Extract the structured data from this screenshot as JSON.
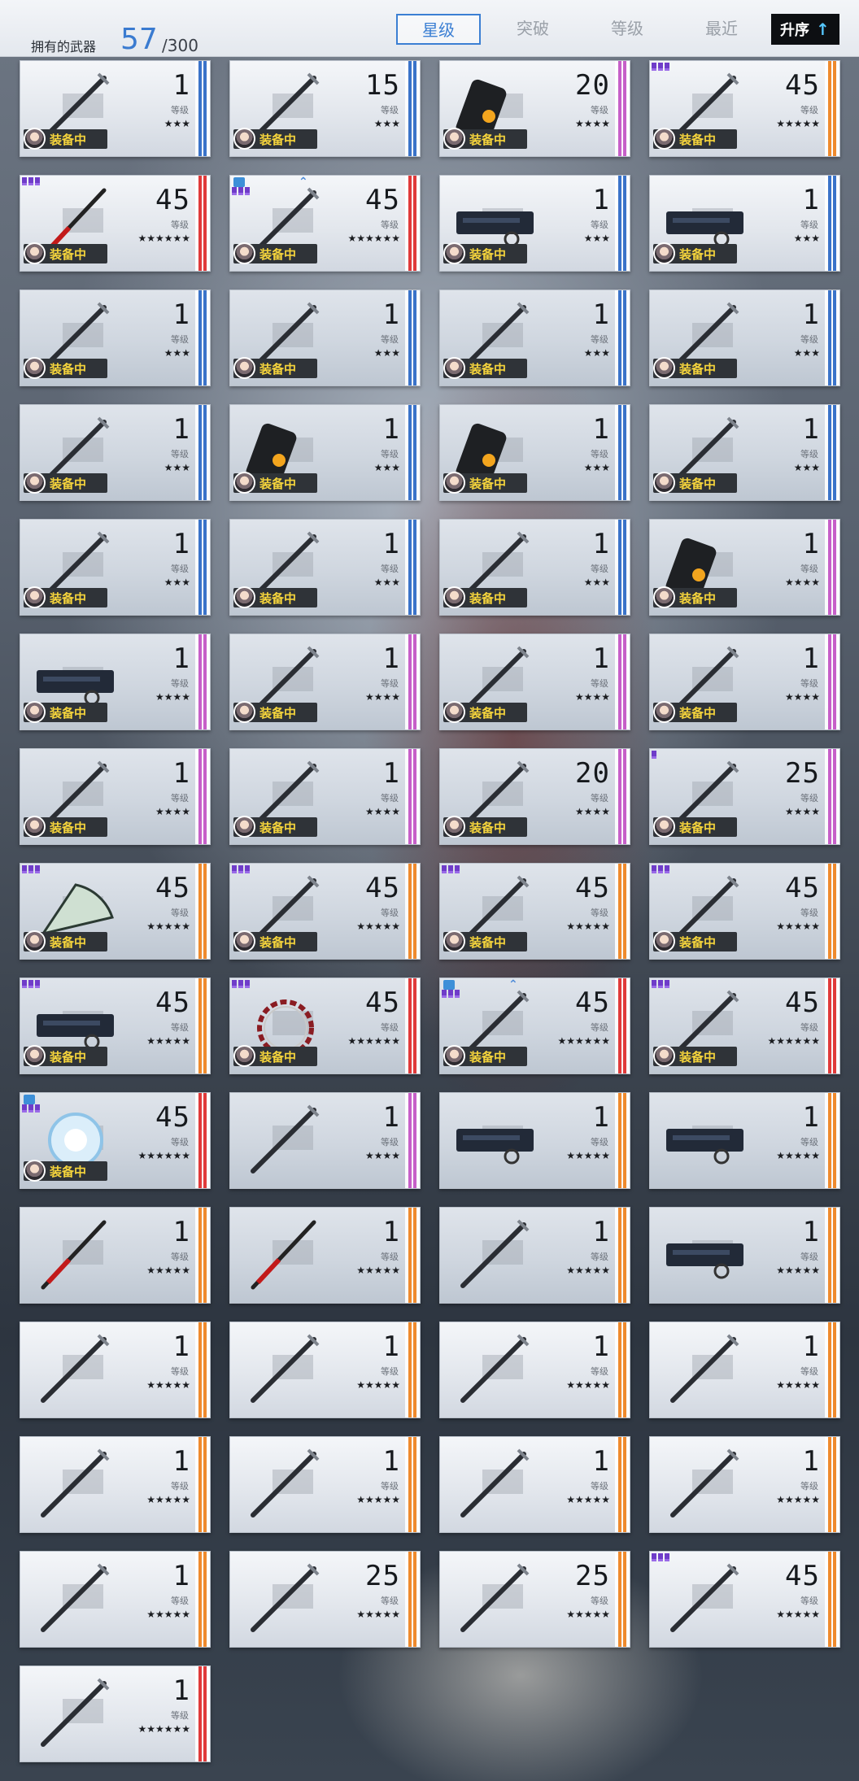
{
  "header": {
    "owned_label": "拥有的武器",
    "owned_count": "57",
    "owned_total": "/300",
    "tabs": [
      {
        "label": "星级",
        "active": true
      },
      {
        "label": "突破",
        "active": false
      },
      {
        "label": "等级",
        "active": false
      },
      {
        "label": "最近",
        "active": false
      }
    ],
    "sort_label": "升序",
    "sort_arrow": "↑"
  },
  "labels": {
    "level": "等级",
    "equipped": "装备中"
  },
  "rarity_colors": {
    "3": "#3a73c9",
    "4": "#c65fc8",
    "5": "#ef8a2d",
    "6": "#e03a3a"
  },
  "weapons": [
    {
      "level": "1",
      "stars": 3,
      "equipped": true,
      "weapon": "scythe-dark-icon"
    },
    {
      "level": "15",
      "stars": 3,
      "equipped": true,
      "weapon": "katana-icon"
    },
    {
      "level": "20",
      "stars": 4,
      "equipped": true,
      "weapon": "gauntlet-cannon-icon"
    },
    {
      "level": "45",
      "stars": 5,
      "equipped": true,
      "weapon": "claw-blades-icon",
      "rank": 3
    },
    {
      "level": "45",
      "stars": 6,
      "equipped": true,
      "weapon": "red-sword-icon",
      "rank": 3
    },
    {
      "level": "45",
      "stars": 6,
      "equipped": true,
      "weapon": "lance-icon",
      "rank": 3,
      "lock": true,
      "upgrade": true
    },
    {
      "level": "1",
      "stars": 3,
      "equipped": true,
      "weapon": "gun-block-icon"
    },
    {
      "level": "1",
      "stars": 3,
      "equipped": true,
      "weapon": "gun-block-icon"
    },
    {
      "level": "1",
      "stars": 3,
      "equipped": true,
      "weapon": "sword-icon"
    },
    {
      "level": "1",
      "stars": 3,
      "equipped": true,
      "weapon": "sword-icon"
    },
    {
      "level": "1",
      "stars": 3,
      "equipped": true,
      "weapon": "sword-icon"
    },
    {
      "level": "1",
      "stars": 3,
      "equipped": true,
      "weapon": "cannon-icon"
    },
    {
      "level": "1",
      "stars": 3,
      "equipped": true,
      "weapon": "dagger-icon"
    },
    {
      "level": "1",
      "stars": 3,
      "equipped": true,
      "weapon": "gauntlet-icon"
    },
    {
      "level": "1",
      "stars": 3,
      "equipped": true,
      "weapon": "gauntlet-icon"
    },
    {
      "level": "1",
      "stars": 3,
      "equipped": true,
      "weapon": "curved-blade-icon"
    },
    {
      "level": "1",
      "stars": 3,
      "equipped": true,
      "weapon": "curved-blade-icon"
    },
    {
      "level": "1",
      "stars": 3,
      "equipped": true,
      "weapon": "pickaxe-icon"
    },
    {
      "level": "1",
      "stars": 3,
      "equipped": true,
      "weapon": "pickaxe-icon"
    },
    {
      "level": "1",
      "stars": 4,
      "equipped": true,
      "weapon": "golden-gauntlet-icon"
    },
    {
      "level": "1",
      "stars": 4,
      "equipped": true,
      "weapon": "rifle-icon"
    },
    {
      "level": "1",
      "stars": 4,
      "equipped": true,
      "weapon": "scythe-icon"
    },
    {
      "level": "1",
      "stars": 4,
      "equipped": true,
      "weapon": "bow-icon"
    },
    {
      "level": "1",
      "stars": 4,
      "equipped": true,
      "weapon": "twin-blades-icon"
    },
    {
      "level": "1",
      "stars": 4,
      "equipped": true,
      "weapon": "axe-icon"
    },
    {
      "level": "1",
      "stars": 4,
      "equipped": true,
      "weapon": "scissors-icon"
    },
    {
      "level": "20",
      "stars": 4,
      "equipped": true,
      "weapon": "sword-icon"
    },
    {
      "level": "25",
      "stars": 4,
      "equipped": true,
      "weapon": "hammer-icon",
      "rank": 1
    },
    {
      "level": "45",
      "stars": 5,
      "equipped": true,
      "weapon": "fan-icon",
      "rank": 3
    },
    {
      "level": "45",
      "stars": 5,
      "equipped": true,
      "weapon": "crystal-sword-icon",
      "rank": 3
    },
    {
      "level": "45",
      "stars": 5,
      "equipped": true,
      "weapon": "sword-icon",
      "rank": 3
    },
    {
      "level": "45",
      "stars": 5,
      "equipped": true,
      "weapon": "doll-icon",
      "rank": 3
    },
    {
      "level": "45",
      "stars": 5,
      "equipped": true,
      "weapon": "gun-blade-icon",
      "rank": 3
    },
    {
      "level": "45",
      "stars": 6,
      "equipped": true,
      "weapon": "ring-icon",
      "rank": 3
    },
    {
      "level": "45",
      "stars": 6,
      "equipped": true,
      "weapon": "staff-icon",
      "rank": 3,
      "lock": true,
      "upgrade": true
    },
    {
      "level": "45",
      "stars": 6,
      "equipped": true,
      "weapon": "spear-icon",
      "rank": 3
    },
    {
      "level": "45",
      "stars": 6,
      "equipped": true,
      "weapon": "crystal-orb-icon",
      "rank": 3,
      "lock": true
    },
    {
      "level": "1",
      "stars": 4,
      "equipped": false,
      "weapon": "baton-icon"
    },
    {
      "level": "1",
      "stars": 5,
      "equipped": false,
      "weapon": "gun-block-icon"
    },
    {
      "level": "1",
      "stars": 5,
      "equipped": false,
      "weapon": "gun-block-icon"
    },
    {
      "level": "1",
      "stars": 5,
      "equipped": false,
      "weapon": "red-sword-icon"
    },
    {
      "level": "1",
      "stars": 5,
      "equipped": false,
      "weapon": "red-sword-icon"
    },
    {
      "level": "1",
      "stars": 5,
      "equipped": false,
      "weapon": "hook-blade-icon"
    },
    {
      "level": "1",
      "stars": 5,
      "equipped": false,
      "weapon": "chainsaw-icon"
    },
    {
      "level": "1",
      "stars": 5,
      "equipped": false,
      "weapon": "scythe-icon"
    },
    {
      "level": "1",
      "stars": 5,
      "equipped": false,
      "weapon": "greatsword-icon"
    },
    {
      "level": "1",
      "stars": 5,
      "equipped": false,
      "weapon": "mace-icon"
    },
    {
      "level": "1",
      "stars": 5,
      "equipped": false,
      "weapon": "mace-icon"
    },
    {
      "level": "1",
      "stars": 5,
      "equipped": false,
      "weapon": "mace-icon"
    },
    {
      "level": "1",
      "stars": 5,
      "equipped": false,
      "weapon": "spear-icon"
    },
    {
      "level": "1",
      "stars": 5,
      "equipped": false,
      "weapon": "cross-sword-icon"
    },
    {
      "level": "1",
      "stars": 5,
      "equipped": false,
      "weapon": "cross-sword-icon"
    },
    {
      "level": "1",
      "stars": 5,
      "equipped": false,
      "weapon": "cross-sword-icon"
    },
    {
      "level": "25",
      "stars": 5,
      "equipped": false,
      "weapon": "mech-wing-icon"
    },
    {
      "level": "25",
      "stars": 5,
      "equipped": false,
      "weapon": "purple-blade-icon"
    },
    {
      "level": "45",
      "stars": 5,
      "equipped": false,
      "weapon": "cross-sword-icon",
      "rank": 3
    },
    {
      "level": "1",
      "stars": 6,
      "equipped": false,
      "weapon": "claw-armor-icon"
    }
  ]
}
